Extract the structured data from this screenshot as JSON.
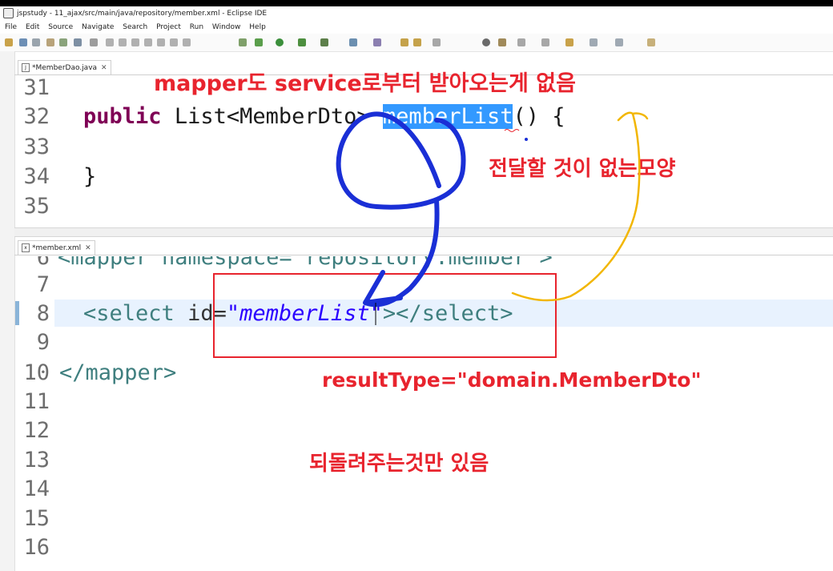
{
  "window": {
    "title": "jspstudy - 11_ajax/src/main/java/repository/member.xml - Eclipse IDE"
  },
  "menu": [
    "File",
    "Edit",
    "Source",
    "Navigate",
    "Search",
    "Project",
    "Run",
    "Window",
    "Help"
  ],
  "tabs": {
    "java_tab": "*MemberDao.java",
    "xml_tab": "*member.xml",
    "close_glyph": "✕"
  },
  "java_editor": {
    "lines": [
      {
        "num": "31",
        "text": ""
      },
      {
        "num": "32",
        "keyword": "public",
        "type": "List<MemberDto>",
        "method": "memberList",
        "rest": "() {"
      },
      {
        "num": "33",
        "text": ""
      },
      {
        "num": "34",
        "text": "}"
      },
      {
        "num": "35",
        "text": ""
      }
    ]
  },
  "xml_editor": {
    "lines": [
      {
        "num": "6",
        "text": "<mapper namespace=\"repository.member\">"
      },
      {
        "num": "7",
        "text": ""
      },
      {
        "num": "8",
        "open": "<select",
        "attr": "id=",
        "value": "\"memberList\"",
        "close": "></select>"
      },
      {
        "num": "9",
        "text": ""
      },
      {
        "num": "10",
        "text": "</mapper>"
      },
      {
        "num": "11",
        "text": ""
      },
      {
        "num": "12",
        "text": ""
      },
      {
        "num": "13",
        "text": ""
      },
      {
        "num": "14",
        "text": ""
      },
      {
        "num": "15",
        "text": ""
      },
      {
        "num": "16",
        "text": ""
      }
    ]
  },
  "annotations": {
    "top_note": "mapper도 service로부터 받아오는게 없음",
    "right_note": "전달할 것이 없는모양",
    "result_type": "resultType=\"domain.MemberDto\"",
    "bottom_note": "되돌려주는것만 있음"
  },
  "colors": {
    "annotation_red": "#e8242e",
    "pen_blue": "#1a2fd6",
    "pen_yellow": "#f2b600",
    "selection": "#3399ff"
  }
}
